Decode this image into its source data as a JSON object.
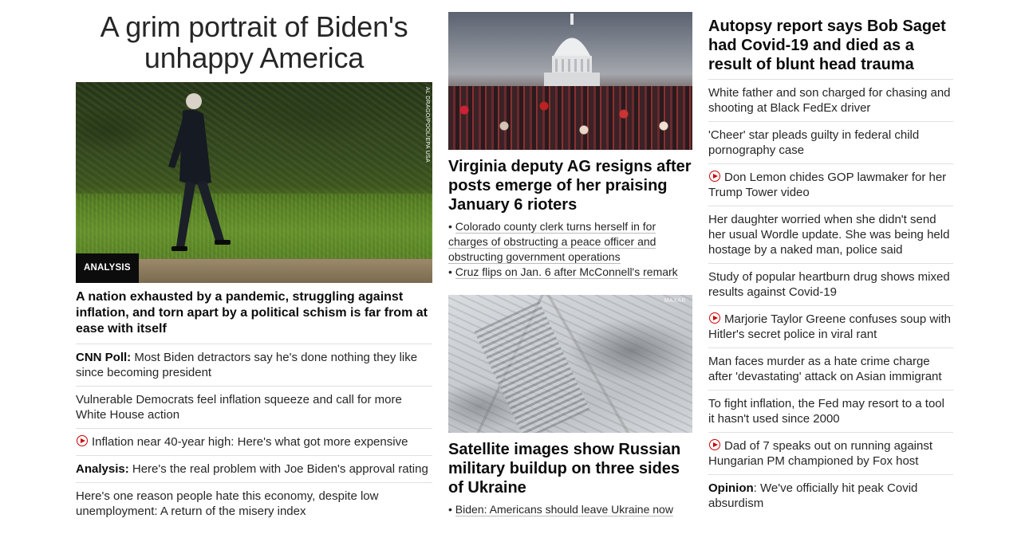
{
  "left": {
    "headline": "A grim portrait of Biden's unhappy America",
    "hero_tag": "ANALYSIS",
    "photo_credit": "AL DRAGO/POOL/EPA USA",
    "hero_headline": "A nation exhausted by a pandemic, struggling against inflation, and torn apart by a political schism is far from at ease with itself",
    "links": [
      {
        "kicker": "CNN Poll:",
        "text": " Most Biden detractors say he's done nothing they like since becoming president",
        "video": false
      },
      {
        "kicker": "",
        "text": "Vulnerable Democrats feel inflation squeeze and call for more White House action",
        "video": false
      },
      {
        "kicker": "",
        "text": "Inflation near 40-year high: Here's what got more expensive",
        "video": true
      },
      {
        "kicker": "Analysis:",
        "text": " Here's the real problem with Joe Biden's approval rating",
        "video": false
      },
      {
        "kicker": "",
        "text": "Here's one reason people hate this economy, despite low unemployment: A return of the misery index",
        "video": false
      }
    ]
  },
  "middle": {
    "card1": {
      "headline": "Virginia deputy AG resigns after posts emerge of her praising January 6 rioters",
      "bullets": [
        "Colorado county clerk turns herself in for charges of obstructing a peace officer and obstructing government operations",
        "Cruz flips on Jan. 6 after McConnell's remark"
      ]
    },
    "card2": {
      "watermark": "MAXAR",
      "headline": "Satellite images show Russian military buildup on three sides of Ukraine",
      "bullets": [
        "Biden: Americans should leave Ukraine now"
      ]
    }
  },
  "right": {
    "headline": "Autopsy report says Bob Saget had Covid-19 and died as a result of blunt head trauma",
    "links": [
      {
        "kicker": "",
        "text": "White father and son charged for chasing and shooting at Black FedEx driver",
        "video": false
      },
      {
        "kicker": "",
        "text": "'Cheer' star pleads guilty in federal child pornography case",
        "video": false
      },
      {
        "kicker": "",
        "text": "Don Lemon chides GOP lawmaker for her Trump Tower video",
        "video": true
      },
      {
        "kicker": "",
        "text": "Her daughter worried when she didn't send her usual Wordle update. She was being held hostage by a naked man, police said",
        "video": false
      },
      {
        "kicker": "",
        "text": "Study of popular heartburn drug shows mixed results against Covid-19",
        "video": false
      },
      {
        "kicker": "",
        "text": "Marjorie Taylor Greene confuses soup with Hitler's secret police in viral rant",
        "video": true
      },
      {
        "kicker": "",
        "text": "Man faces murder as a hate crime charge after 'devastating' attack on Asian immigrant",
        "video": false
      },
      {
        "kicker": "",
        "text": "To fight inflation, the Fed may resort to a tool it hasn't used since 2000",
        "video": false
      },
      {
        "kicker": "",
        "text": "Dad of 7 speaks out on running against Hungarian PM championed by Fox host",
        "video": true
      },
      {
        "kicker": "Opinion",
        "text": ": We've officially hit peak Covid absurdism",
        "video": false
      }
    ]
  },
  "colors": {
    "video_icon": "#cc0000",
    "tag_bg": "#0c0c0c",
    "divider": "#e0e0e0"
  },
  "icons": {
    "video": "play-circle-icon"
  }
}
